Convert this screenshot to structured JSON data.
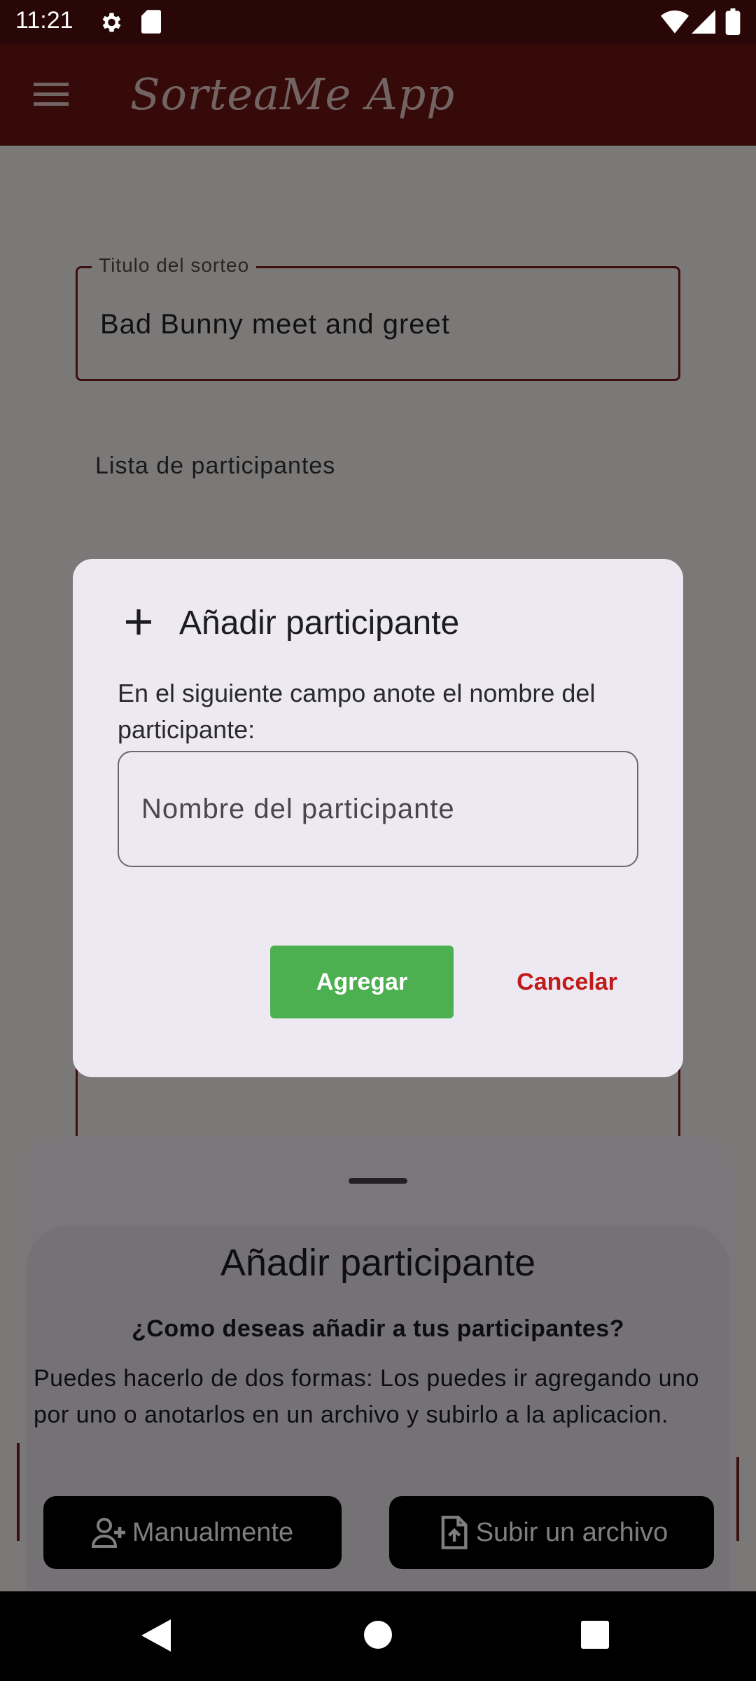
{
  "status_bar": {
    "time": "11:21"
  },
  "app_bar": {
    "title": "SorteaMe App"
  },
  "form": {
    "title_field_label": "Titulo del sorteo",
    "title_field_value": "Bad Bunny meet and greet",
    "participants_label": "Lista de participantes"
  },
  "dialog": {
    "title": "Añadir participante",
    "description": "En el siguiente campo anote el nombre del participante:",
    "name_placeholder": "Nombre del participante",
    "add_label": "Agregar",
    "cancel_label": "Cancelar"
  },
  "bottom_sheet": {
    "title": "Añadir participante",
    "question": "¿Como deseas añadir a tus participantes?",
    "description": "Puedes hacerlo de dos formas: Los puedes ir agregando uno por uno o anotarlos en un archivo y subirlo a la aplicacion.",
    "manual_label": "Manualmente",
    "upload_label": "Subir un archivo"
  },
  "colors": {
    "status_bar": "#2a0707",
    "app_bar": "#6f1515",
    "add_button": "#4caf50",
    "cancel_text": "#c01a1a"
  }
}
